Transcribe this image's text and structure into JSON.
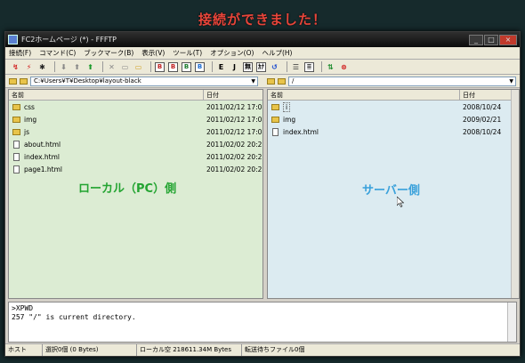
{
  "headline": "接続ができました！",
  "window": {
    "title": "FC2ホームページ (*) - FFFTP",
    "minimize": "_",
    "maximize": "□",
    "close": "×"
  },
  "menu": [
    "接続(F)",
    "コマンド(C)",
    "ブックマーク(B)",
    "表示(V)",
    "ツール(T)",
    "オプション(O)",
    "ヘルプ(H)"
  ],
  "toolbar": {
    "text_buttons": [
      "B",
      "B",
      "B",
      "B",
      "E",
      "J",
      "無",
      "ｶﾅ"
    ]
  },
  "local": {
    "path": "C:¥Users¥T¥Desktop¥layout-black",
    "col_name": "名前",
    "col_date": "日付",
    "files": [
      {
        "name": "css",
        "date": "2011/02/12 17:0",
        "type": "folder"
      },
      {
        "name": "img",
        "date": "2011/02/12 17:0",
        "type": "folder"
      },
      {
        "name": "js",
        "date": "2011/02/12 17:0",
        "type": "folder"
      },
      {
        "name": "about.html",
        "date": "2011/02/02 20:2",
        "type": "file"
      },
      {
        "name": "index.html",
        "date": "2011/02/02 20:2",
        "type": "file"
      },
      {
        "name": "page1.html",
        "date": "2011/02/02 20:2",
        "type": "file"
      }
    ],
    "overlay": "ローカル（PC）側"
  },
  "remote": {
    "path": "/",
    "col_name": "名前",
    "col_date": "日付",
    "files": [
      {
        "name": "i",
        "date": "2008/10/24",
        "type": "folder"
      },
      {
        "name": "img",
        "date": "2009/02/21",
        "type": "folder"
      },
      {
        "name": "index.html",
        "date": "2008/10/24",
        "type": "file"
      }
    ],
    "overlay": "サーバー側"
  },
  "log": {
    "line1": ">XPWD",
    "line2": "257 \"/\" is current directory."
  },
  "status": {
    "host": "ホスト",
    "selected": "選択0個 (0 Bytes)",
    "free": "ローカル空 218611.34M Bytes",
    "queue": "転送待ちファイル0個"
  },
  "colors": {
    "headline": "#e8453a",
    "local_bg": "#dcecd3",
    "remote_bg": "#dcebf1",
    "local_overlay": "#23a431",
    "remote_overlay": "#3aa1db"
  }
}
